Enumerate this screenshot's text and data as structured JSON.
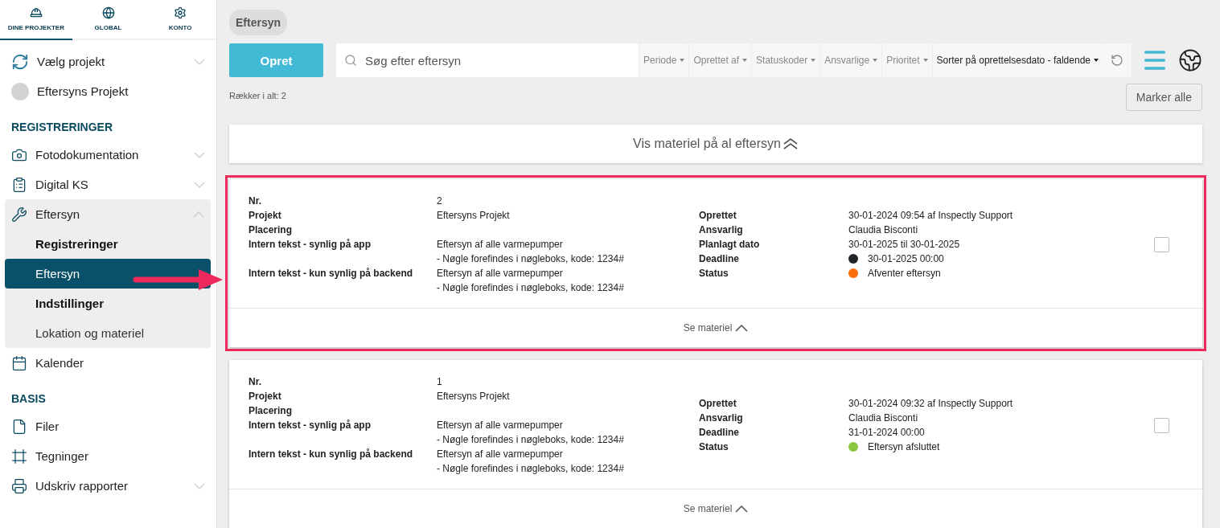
{
  "top_tabs": [
    {
      "label": "DINE PROJEKTER",
      "selected": true
    },
    {
      "label": "GLOBAL",
      "selected": false
    },
    {
      "label": "KONTO",
      "selected": false
    }
  ],
  "project_picker": {
    "label": "Vælg projekt",
    "expanded": false
  },
  "project": {
    "name": "Eftersyns Projekt"
  },
  "sections": [
    {
      "title": "REGISTRERINGER",
      "items": [
        {
          "label": "Fotodokumentation",
          "expanded": false
        },
        {
          "label": "Digital KS",
          "expanded": false
        },
        {
          "label": "Eftersyn",
          "expanded": true,
          "children": [
            {
              "label": "Registreringer",
              "kind": "heading",
              "selected": false
            },
            {
              "label": "Eftersyn",
              "kind": "link",
              "selected": true
            },
            {
              "label": "Indstillinger",
              "kind": "heading",
              "selected": false
            },
            {
              "label": "Lokation og materiel",
              "kind": "link",
              "selected": false
            }
          ]
        },
        {
          "label": "Kalender"
        }
      ]
    },
    {
      "title": "BASIS",
      "items": [
        {
          "label": "Filer"
        },
        {
          "label": "Tegninger"
        },
        {
          "label": "Udskriv rapporter",
          "expanded": false
        }
      ]
    }
  ],
  "breadcrumb": "Eftersyn",
  "toolbar": {
    "create": "Opret",
    "search_placeholder": "Søg efter eftersyn",
    "filters": [
      {
        "label": "Periode",
        "kind": "filter"
      },
      {
        "label": "Oprettet af",
        "kind": "filter"
      },
      {
        "label": "Statuskoder",
        "kind": "filter"
      },
      {
        "label": "Ansvarlige",
        "kind": "filter"
      },
      {
        "label": "Prioritet",
        "kind": "filter"
      },
      {
        "label": "Sorter på oprettelsesdato - faldende",
        "kind": "sort"
      }
    ]
  },
  "row_count": "Rækker i alt: 2",
  "mark_all": "Marker alle",
  "show_all_material": "Vis materiel på al eftersyn",
  "cards": [
    {
      "highlighted": true,
      "checked": false,
      "left": [
        {
          "label": "Nr.",
          "value": [
            "2"
          ]
        },
        {
          "label": "Projekt",
          "value": [
            "Eftersyns Projekt"
          ]
        },
        {
          "label": "Placering"
        },
        {
          "label": "Intern tekst - synlig på app",
          "value": [
            "Eftersyn af alle varmepumper",
            "- Nøgle forefindes i nøgleboks, kode: 1234#"
          ]
        },
        {
          "label": "Intern tekst - kun synlig på backend",
          "value": [
            "Eftersyn af alle varmepumper",
            "- Nøgle forefindes i nøgleboks, kode: 1234#"
          ]
        }
      ],
      "right": [
        {
          "label": "Oprettet",
          "value": "30-01-2024 09:54 af Inspectly Support"
        },
        {
          "label": "Ansvarlig",
          "value": "Claudia Bisconti"
        },
        {
          "label": "Planlagt dato",
          "value": "30-01-2025 til 30-01-2025"
        },
        {
          "label": "Deadline",
          "value": "30-01-2025 00:00",
          "color": "#212529"
        },
        {
          "label": "Status",
          "value": "Afventer eftersyn",
          "color": "#fd6d0b"
        }
      ],
      "footer": "Se materiel"
    },
    {
      "highlighted": false,
      "checked": false,
      "left": [
        {
          "label": "Nr.",
          "value": [
            "1"
          ]
        },
        {
          "label": "Projekt",
          "value": [
            "Eftersyns Projekt"
          ]
        },
        {
          "label": "Placering"
        },
        {
          "label": "Intern tekst - synlig på app",
          "value": [
            "Eftersyn af alle varmepumper",
            "- Nøgle forefindes i nøgleboks, kode: 1234#"
          ]
        },
        {
          "label": "Intern tekst - kun synlig på backend",
          "value": [
            "Eftersyn af alle varmepumper",
            "- Nøgle forefindes i nøgleboks, kode: 1234#"
          ]
        }
      ],
      "right": [
        {
          "label": "Oprettet",
          "value": "30-01-2024 09:32 af Inspectly Support"
        },
        {
          "label": "Ansvarlig",
          "value": "Claudia Bisconti"
        },
        {
          "label": "Deadline",
          "value": "31-01-2024 00:00"
        },
        {
          "label": "Status",
          "value": "Eftersyn afsluttet",
          "color": "#8dc63f"
        }
      ],
      "footer": "Se materiel"
    }
  ]
}
